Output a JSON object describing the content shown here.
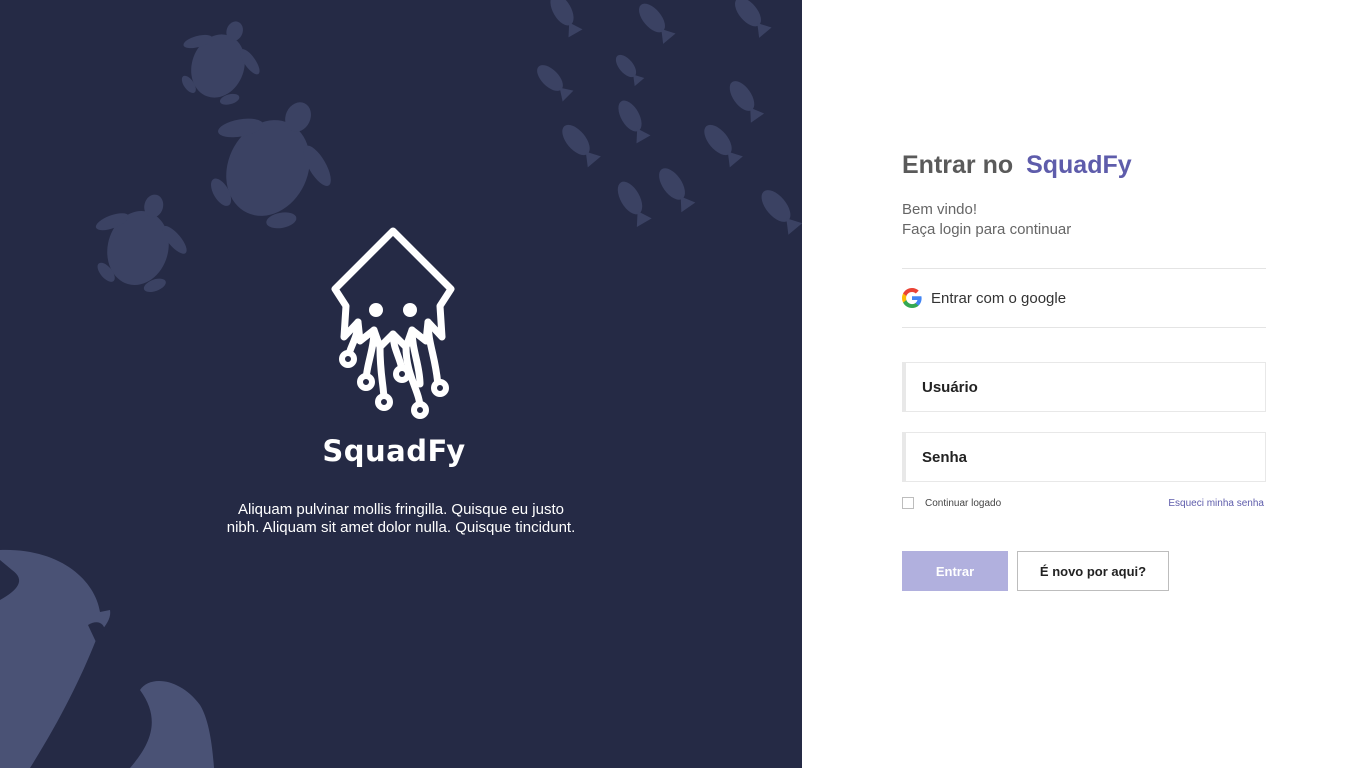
{
  "colors": {
    "left_background": "#252a45",
    "decoration": "#3b4263",
    "decoration_light": "#4a5275",
    "brand_accent": "#5e5cab",
    "primary_button": "#b1b0de"
  },
  "branding": {
    "logo_icon": "squid-circuit-icon",
    "name": "SquadFy",
    "tagline_line1": "Aliquam pulvinar mollis fringilla. Quisque eu justo",
    "tagline_line2": "nibh. Aliquam sit amet dolor nulla. Quisque tincidunt."
  },
  "login": {
    "title_prefix": "Entrar no",
    "title_brand": "SquadFy",
    "welcome_line1": "Bem vindo!",
    "welcome_line2": "Faça login para continuar",
    "google_icon": "google-g-icon",
    "google_label": "Entrar com o google",
    "username_placeholder": "Usuário",
    "password_placeholder": "Senha",
    "keep_logged_label": "Continuar logado",
    "keep_logged_checked": false,
    "forgot_password": "Esqueci minha senha",
    "submit_label": "Entrar",
    "signup_label": "É novo por aqui?"
  }
}
